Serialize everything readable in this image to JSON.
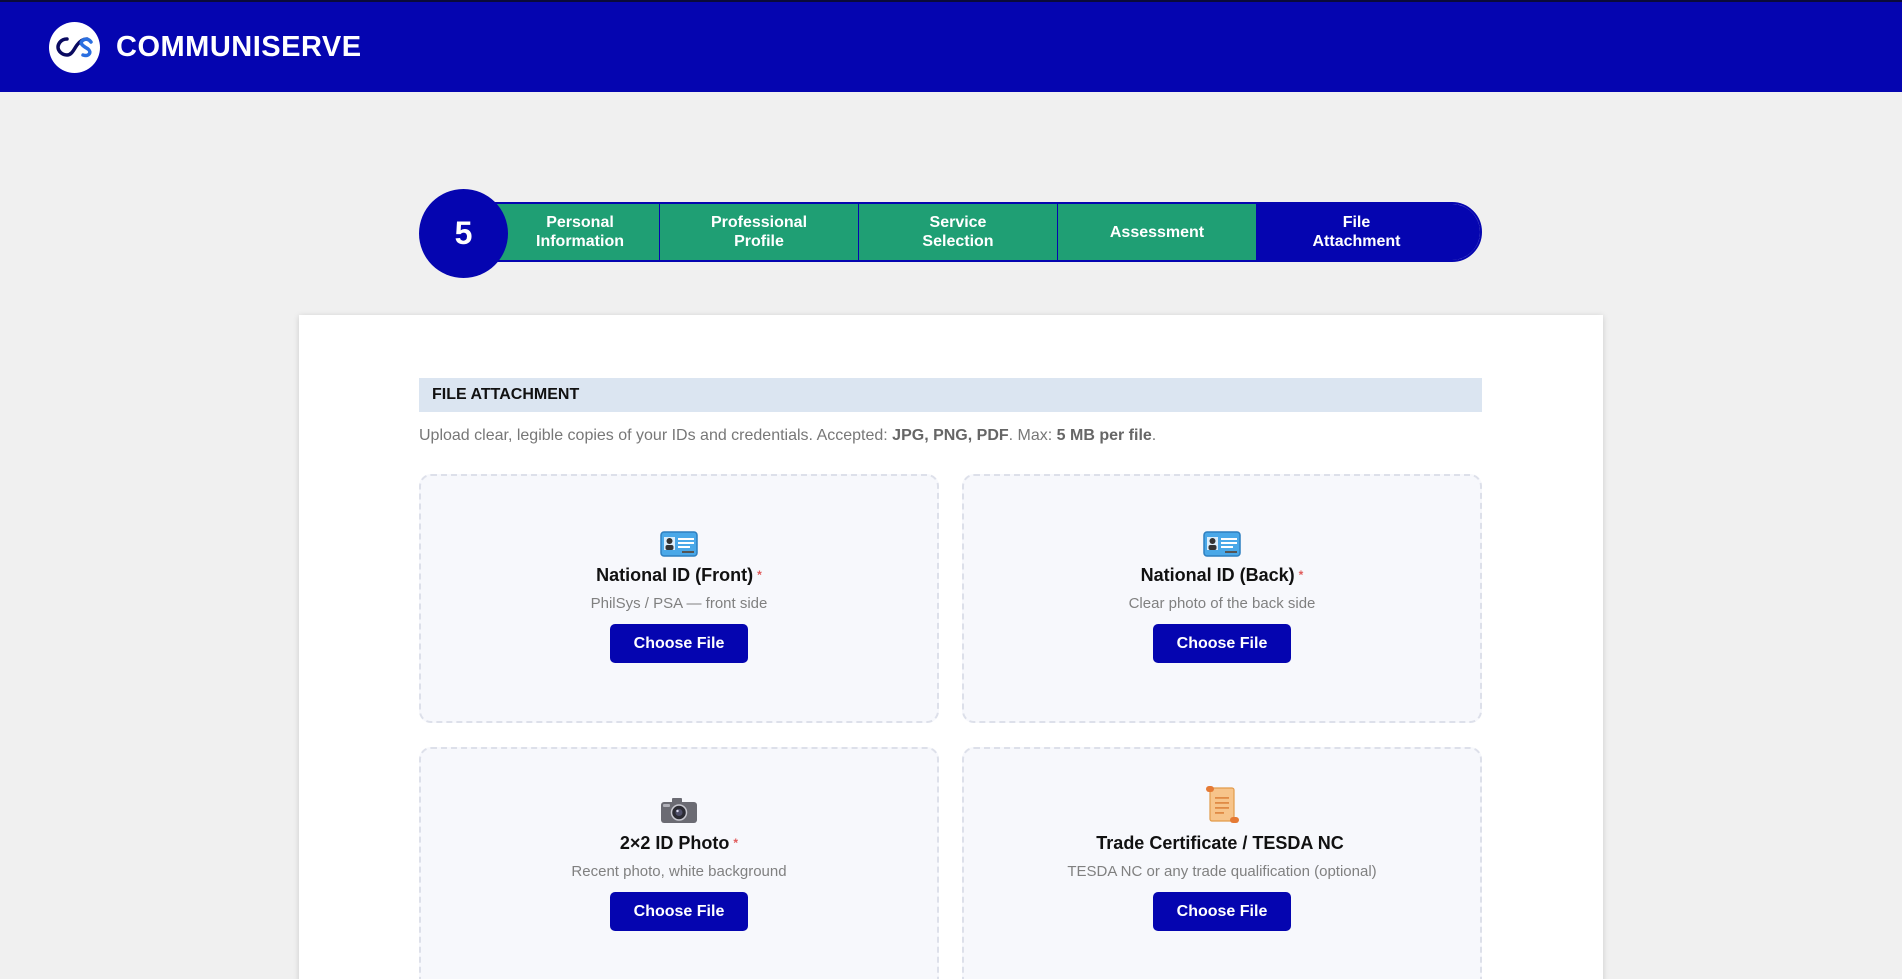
{
  "header": {
    "brand": "COMMUNISERVE",
    "logo_text": "CS"
  },
  "stepper": {
    "current": "5",
    "steps": [
      {
        "line1": "Personal",
        "line2": "Information"
      },
      {
        "line1": "Professional",
        "line2": "Profile"
      },
      {
        "line1": "Service",
        "line2": "Selection"
      },
      {
        "line1": "Assessment",
        "line2": ""
      },
      {
        "line1": "File",
        "line2": "Attachment"
      }
    ]
  },
  "section": {
    "title": "FILE ATTACHMENT",
    "help_prefix": "Upload clear, legible copies of your IDs and credentials. Accepted: ",
    "help_types": "JPG, PNG, PDF",
    "help_mid": ". Max: ",
    "help_size": "5 MB per file",
    "help_end": "."
  },
  "uploads": [
    {
      "icon": "id-card-icon",
      "title": "National ID (Front)",
      "required": "*",
      "subtitle": "PhilSys / PSA — front side",
      "button": "Choose File"
    },
    {
      "icon": "id-card-icon",
      "title": "National ID (Back)",
      "required": "*",
      "subtitle": "Clear photo of the back side",
      "button": "Choose File"
    },
    {
      "icon": "camera-icon",
      "title": "2×2 ID Photo",
      "required": "*",
      "subtitle": "Recent photo, white background",
      "button": "Choose File"
    },
    {
      "icon": "scroll-icon",
      "title": "Trade Certificate / TESDA NC",
      "required": "",
      "subtitle": "TESDA NC or any trade qualification (optional)",
      "button": "Choose File"
    }
  ],
  "colors": {
    "primary": "#0505b0",
    "step_done": "#1f9f74",
    "section_bg": "#dbe5f1",
    "required": "#e05a5a"
  }
}
